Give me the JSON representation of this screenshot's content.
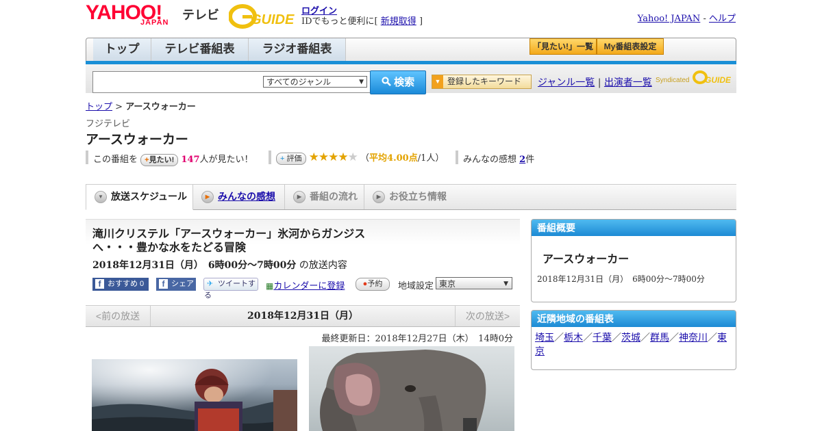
{
  "header": {
    "yahoo_logo": "YAHOO!",
    "japan_logo": "JAPAN",
    "tv_label": "テレビ",
    "gguide_logo": "G-GUIDE",
    "login_link": "ログイン",
    "login_sub_prefix": "IDでもっと便利に[",
    "register_link": "新規取得",
    "login_sub_suffix": "]",
    "yahoo_japan_link": "Yahoo! JAPAN",
    "separator": "-",
    "help_link": "ヘルプ"
  },
  "nav": {
    "tabs": [
      "トップ",
      "テレビ番組表",
      "ラジオ番組表"
    ],
    "mitai_list_button": "「見たい!」一覧",
    "my_schedule_button": "My番組表設定"
  },
  "search": {
    "placeholder": "",
    "genre_selected": "すべてのジャンル",
    "search_button": "検索",
    "keyword_button": "登録したキーワード",
    "genre_list_link": "ジャンル一覧",
    "divider": "|",
    "cast_list_link": "出演者一覧",
    "syndicated": "Syndicated"
  },
  "breadcrumb": {
    "top_link": "トップ",
    "sep": ">",
    "current": "アースウォーカー"
  },
  "program": {
    "station": "フジテレビ",
    "title": "アースウォーカー",
    "mitai_prefix": "この番組を",
    "mitai_button": "見たい!",
    "mitai_count": "147",
    "mitai_suffix": "人が見たい！",
    "eval_button": "評価",
    "rating_stars": 4,
    "rating_max": 5,
    "rating_open": "（",
    "rating_avg": "平均4.00点",
    "rating_count": "/1人",
    "rating_close": "）",
    "kansou_label": "みんなの感想",
    "kansou_count": "2",
    "kansou_unit": "件"
  },
  "tabs": [
    {
      "label": "放送スケジュール",
      "active": true
    },
    {
      "label": "みんなの感想",
      "active": false,
      "link": true
    },
    {
      "label": "番組の流れ",
      "active": false
    },
    {
      "label": "お役立ち情報",
      "active": false
    }
  ],
  "episode": {
    "title": "滝川クリステル「アースウォーカー」氷河からガンジスへ・・・豊かな水をたどる冒険",
    "date_time": "2018年12月31日（月）　6時00分～7時00分",
    "date_suffix": "の放送内容",
    "fb_recommend": "おすすめ 0",
    "fb_share": "シェア",
    "tweet": "ツイートする",
    "calendar_link": "カレンダーに登録",
    "reserve_button": "予約",
    "region_label": "地域設定",
    "region_selected": "東京"
  },
  "pager": {
    "prev": "<前の放送",
    "current": "2018年12月31日（月）",
    "next": "次の放送>"
  },
  "updated": "最終更新日：2018年12月27日（木）　14時0分",
  "sidebar": {
    "overview_head": "番組概要",
    "overview_title": "アースウォーカー",
    "overview_time": "2018年12月31日（月）　6時00分～7時00分",
    "nearby_head": "近隣地域の番組表",
    "nearby_regions": [
      "埼玉",
      "栃木",
      "千葉",
      "茨城",
      "群馬",
      "神奈川",
      "東京"
    ],
    "nearby_sep": "／"
  },
  "colors": {
    "accent_blue": "#1a8fd6",
    "yahoo_red": "#ff0033",
    "mitai_count": "#e0006e",
    "rating_orange": "#e3a300"
  }
}
